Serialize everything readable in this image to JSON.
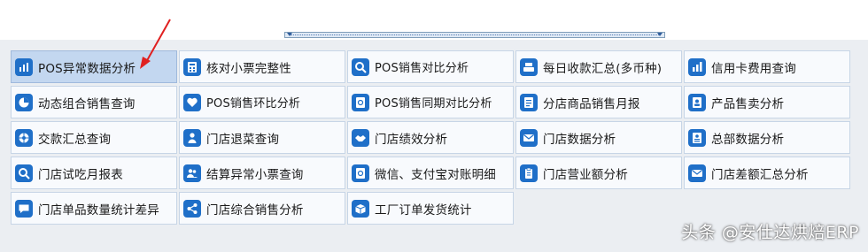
{
  "tiles": [
    {
      "label": "POS异常数据分析",
      "icon": "pos-report-icon"
    },
    {
      "label": "核对小票完整性",
      "icon": "calculator-icon"
    },
    {
      "label": "POS销售对比分析",
      "icon": "search-icon"
    },
    {
      "label": "每日收款汇总(多币种)",
      "icon": "cash-register-icon"
    },
    {
      "label": "信用卡费用查询",
      "icon": "bar-chart-icon"
    },
    {
      "label": "动态组合销售查询",
      "icon": "pie-chart-icon"
    },
    {
      "label": "POS销售环比分析",
      "icon": "heart-icon"
    },
    {
      "label": "POS销售同期对比分析",
      "icon": "contact-card-icon"
    },
    {
      "label": "分店商品销售月报",
      "icon": "document-icon"
    },
    {
      "label": "产品售卖分析",
      "icon": "person-card-icon"
    },
    {
      "label": "交款汇总查询",
      "icon": "aperture-icon"
    },
    {
      "label": "门店退菜查询",
      "icon": "person-icon"
    },
    {
      "label": "门店绩效分析",
      "icon": "handshake-icon"
    },
    {
      "label": "门店数据分析",
      "icon": "envelope-icon"
    },
    {
      "label": "总部数据分析",
      "icon": "person-list-icon"
    },
    {
      "label": "门店试吃月报表",
      "icon": "magnifier-icon"
    },
    {
      "label": "结算异常小票查询",
      "icon": "users-icon"
    },
    {
      "label": "微信、支付宝对账明细",
      "icon": "at-card-icon"
    },
    {
      "label": "门店营业额分析",
      "icon": "clipboard-icon"
    },
    {
      "label": "门店差额汇总分析",
      "icon": "mail-icon"
    },
    {
      "label": "门店单品数量统计差异",
      "icon": "chat-icon"
    },
    {
      "label": "门店综合销售分析",
      "icon": "share-icon"
    },
    {
      "label": "工厂订单发货统计",
      "icon": "box-icon"
    }
  ],
  "selected_index": 0,
  "watermark": "头条 @安仕达烘焙ERP",
  "colors": {
    "icon_bg": "#1f6fc8",
    "tile_bg": "#f8fafd",
    "selected_bg": "#c3d7f0",
    "panel_bg": "#ebeef2",
    "annotation_arrow": "#e02020"
  }
}
